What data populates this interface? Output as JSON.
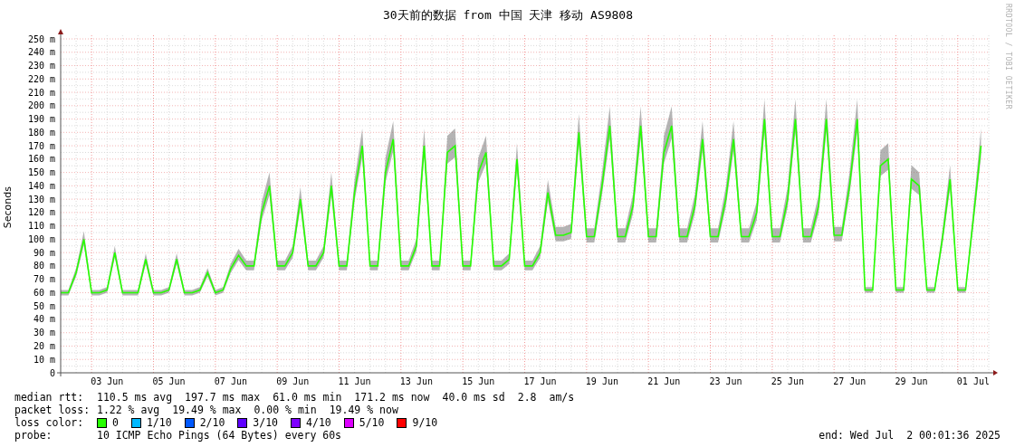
{
  "chart_data": {
    "type": "line",
    "title": "30天前的数据 from 中国 天津 移动 AS9808",
    "ylabel": "Seconds",
    "ylim": [
      0,
      250
    ],
    "grid": true,
    "categories": [
      null,
      null,
      null,
      null,
      null,
      null,
      "03 Jun",
      null,
      null,
      null,
      null,
      null,
      null,
      null,
      "05 Jun",
      null,
      null,
      null,
      null,
      null,
      null,
      null,
      "07 Jun",
      null,
      null,
      null,
      null,
      null,
      null,
      null,
      "09 Jun",
      null,
      null,
      null,
      null,
      null,
      null,
      null,
      "11 Jun",
      null,
      null,
      null,
      null,
      null,
      null,
      null,
      "13 Jun",
      null,
      null,
      null,
      null,
      null,
      null,
      null,
      "15 Jun",
      null,
      null,
      null,
      null,
      null,
      null,
      null,
      "17 Jun",
      null,
      null,
      null,
      null,
      null,
      null,
      null,
      "19 Jun",
      null,
      null,
      null,
      null,
      null,
      null,
      null,
      "21 Jun",
      null,
      null,
      null,
      null,
      null,
      null,
      null,
      "23 Jun",
      null,
      null,
      null,
      null,
      null,
      null,
      null,
      "25 Jun",
      null,
      null,
      null,
      null,
      null,
      null,
      null,
      "27 Jun",
      null,
      null,
      null,
      null,
      null,
      null,
      null,
      "29 Jun",
      null,
      null,
      null,
      null,
      null,
      null,
      null,
      "01 Jul",
      null
    ],
    "yticks": [
      {
        "value": 0,
        "label": "0"
      },
      {
        "value": 10,
        "label": "10 m"
      },
      {
        "value": 20,
        "label": "20 m"
      },
      {
        "value": 30,
        "label": "30 m"
      },
      {
        "value": 40,
        "label": "40 m"
      },
      {
        "value": 50,
        "label": "50 m"
      },
      {
        "value": 60,
        "label": "60 m"
      },
      {
        "value": 70,
        "label": "70 m"
      },
      {
        "value": 80,
        "label": "80 m"
      },
      {
        "value": 90,
        "label": "90 m"
      },
      {
        "value": 100,
        "label": "100 m"
      },
      {
        "value": 110,
        "label": "110 m"
      },
      {
        "value": 120,
        "label": "120 m"
      },
      {
        "value": 130,
        "label": "130 m"
      },
      {
        "value": 140,
        "label": "140 m"
      },
      {
        "value": 150,
        "label": "150 m"
      },
      {
        "value": 160,
        "label": "160 m"
      },
      {
        "value": 170,
        "label": "170 m"
      },
      {
        "value": 180,
        "label": "180 m"
      },
      {
        "value": 190,
        "label": "190 m"
      },
      {
        "value": 200,
        "label": "200 m"
      },
      {
        "value": 210,
        "label": "210 m"
      },
      {
        "value": 220,
        "label": "220 m"
      },
      {
        "value": 230,
        "label": "230 m"
      },
      {
        "value": 240,
        "label": "240 m"
      },
      {
        "value": 250,
        "label": "250 m"
      }
    ],
    "series": [
      {
        "color": "#26ff00",
        "values": [
          60,
          60,
          75,
          100,
          60,
          60,
          62,
          90,
          60,
          60,
          60,
          85,
          60,
          60,
          62,
          85,
          60,
          60,
          62,
          75,
          60,
          62,
          78,
          88,
          80,
          80,
          120,
          140,
          80,
          80,
          90,
          130,
          80,
          80,
          90,
          140,
          80,
          80,
          135,
          170,
          80,
          80,
          150,
          175,
          80,
          80,
          95,
          170,
          80,
          80,
          165,
          170,
          80,
          80,
          150,
          165,
          80,
          80,
          85,
          160,
          80,
          80,
          90,
          135,
          103,
          103,
          105,
          180,
          102,
          102,
          140,
          185,
          102,
          102,
          125,
          185,
          102,
          102,
          165,
          185,
          102,
          102,
          125,
          175,
          102,
          102,
          130,
          175,
          102,
          102,
          120,
          190,
          102,
          102,
          130,
          190,
          102,
          102,
          125,
          190,
          103,
          103,
          140,
          190,
          62,
          62,
          155,
          160,
          62,
          62,
          145,
          140,
          62,
          62,
          100,
          145,
          62,
          62,
          115,
          170
        ]
      }
    ]
  },
  "credit": "RRDTOOL / TOBI OETIKER",
  "legend": {
    "median_rtt": {
      "label": "median rtt:",
      "values": [
        "110.5 ms avg",
        "197.7 ms max",
        "61.0 ms min",
        "171.2 ms now",
        "40.0 ms sd",
        "2.8",
        "am/s"
      ]
    },
    "packet_loss": {
      "label": "packet loss:",
      "values": [
        "1.22 % avg",
        "19.49 % max",
        "0.00 % min",
        "19.49 % now"
      ]
    },
    "loss_color": {
      "label": "loss color:",
      "items": [
        {
          "label": "0",
          "color": "#26ff00"
        },
        {
          "label": "1/10",
          "color": "#00b8ff"
        },
        {
          "label": "2/10",
          "color": "#0059ff"
        },
        {
          "label": "3/10",
          "color": "#5e00ff"
        },
        {
          "label": "4/10",
          "color": "#7e00ff"
        },
        {
          "label": "5/10",
          "color": "#dd00ff"
        },
        {
          "label": "9/10",
          "color": "#ff0000"
        }
      ]
    },
    "probe": {
      "label": "probe:",
      "value": "10 ICMP Echo Pings (64 Bytes) every 60s"
    },
    "end": "end: Wed Jul  2 00:01:36 2025"
  }
}
